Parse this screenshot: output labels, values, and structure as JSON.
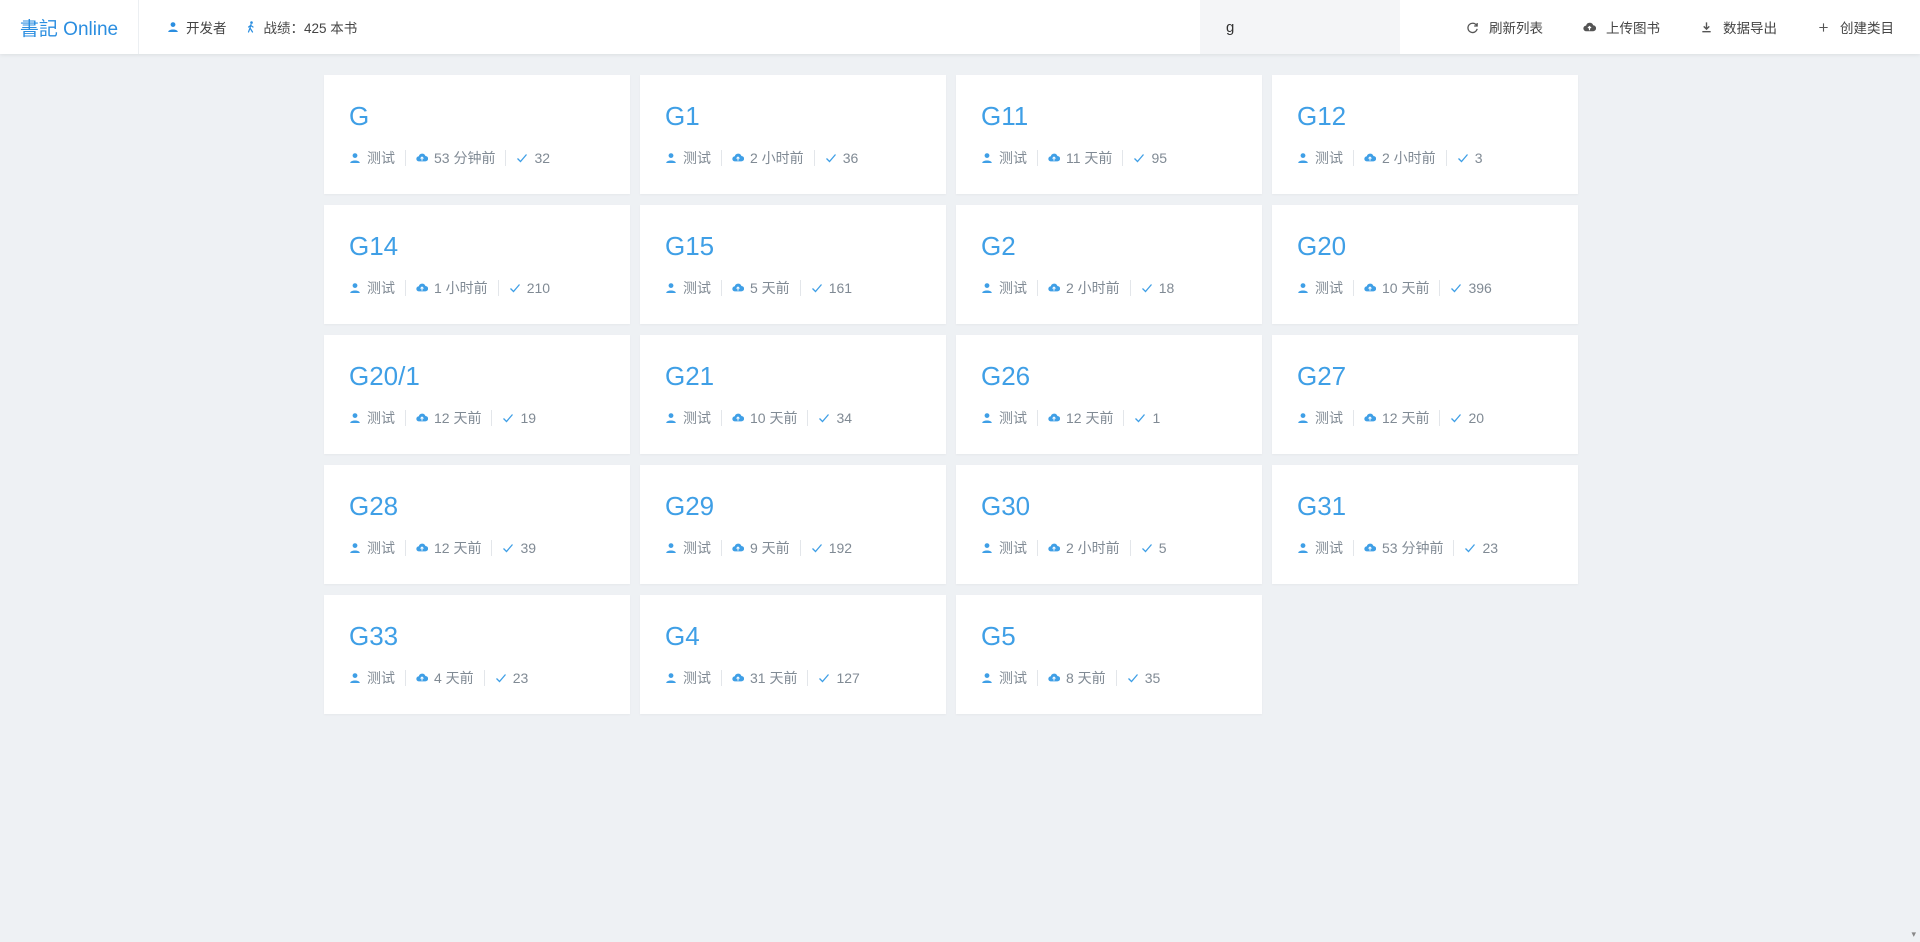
{
  "header": {
    "brand": "書記 Online",
    "user_label": "开发者",
    "stats_label": "战绩：425 本书",
    "search_value": "g",
    "actions": [
      {
        "label": "刷新列表",
        "icon": "refresh-icon"
      },
      {
        "label": "上传图书",
        "icon": "upload-cloud-icon"
      },
      {
        "label": "数据导出",
        "icon": "download-icon"
      },
      {
        "label": "创建类目",
        "icon": "plus-icon"
      }
    ]
  },
  "cards": [
    {
      "title": "G",
      "user": "测试",
      "time": "53 分钟前",
      "count": "32"
    },
    {
      "title": "G1",
      "user": "测试",
      "time": "2 小时前",
      "count": "36"
    },
    {
      "title": "G11",
      "user": "测试",
      "time": "11 天前",
      "count": "95"
    },
    {
      "title": "G12",
      "user": "测试",
      "time": "2 小时前",
      "count": "3"
    },
    {
      "title": "G14",
      "user": "测试",
      "time": "1 小时前",
      "count": "210"
    },
    {
      "title": "G15",
      "user": "测试",
      "time": "5 天前",
      "count": "161"
    },
    {
      "title": "G2",
      "user": "测试",
      "time": "2 小时前",
      "count": "18"
    },
    {
      "title": "G20",
      "user": "测试",
      "time": "10 天前",
      "count": "396"
    },
    {
      "title": "G20/1",
      "user": "测试",
      "time": "12 天前",
      "count": "19"
    },
    {
      "title": "G21",
      "user": "测试",
      "time": "10 天前",
      "count": "34"
    },
    {
      "title": "G26",
      "user": "测试",
      "time": "12 天前",
      "count": "1"
    },
    {
      "title": "G27",
      "user": "测试",
      "time": "12 天前",
      "count": "20"
    },
    {
      "title": "G28",
      "user": "测试",
      "time": "12 天前",
      "count": "39"
    },
    {
      "title": "G29",
      "user": "测试",
      "time": "9 天前",
      "count": "192"
    },
    {
      "title": "G30",
      "user": "测试",
      "time": "2 小时前",
      "count": "5"
    },
    {
      "title": "G31",
      "user": "测试",
      "time": "53 分钟前",
      "count": "23"
    },
    {
      "title": "G33",
      "user": "测试",
      "time": "4 天前",
      "count": "23"
    },
    {
      "title": "G4",
      "user": "测试",
      "time": "31 天前",
      "count": "127"
    },
    {
      "title": "G5",
      "user": "测试",
      "time": "8 天前",
      "count": "35"
    }
  ],
  "colors": {
    "accent": "#3f9fe6",
    "brand": "#2b8ee0",
    "background": "#eef1f4"
  }
}
